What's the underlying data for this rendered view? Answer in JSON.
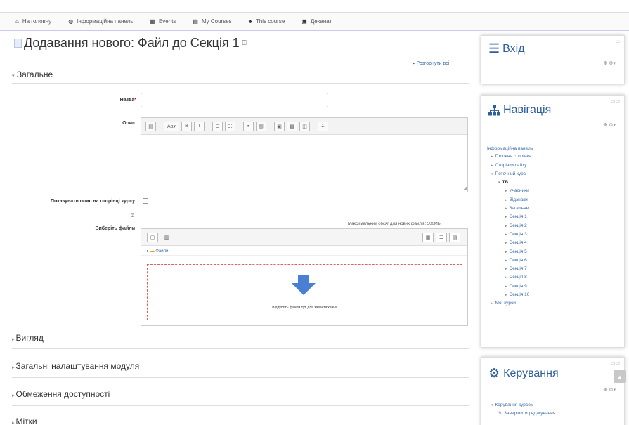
{
  "topnav": {
    "items": [
      {
        "icon": "home-icon",
        "glyph": "⌂",
        "label": "На головну"
      },
      {
        "icon": "dashboard-icon",
        "glyph": "◍",
        "label": "Інформаційна панель"
      },
      {
        "icon": "calendar-icon",
        "glyph": "▦",
        "label": "Events"
      },
      {
        "icon": "courses-icon",
        "glyph": "▤",
        "label": "My Courses"
      },
      {
        "icon": "sitemap-icon",
        "glyph": "♣",
        "label": "This course"
      },
      {
        "icon": "grades-icon",
        "glyph": "▣",
        "label": "Деканат"
      }
    ]
  },
  "page": {
    "title": "Додавання нового: Файл до Секція 1",
    "expand_all": "Розгорнути всі",
    "section_general": "Загальне"
  },
  "form": {
    "name_label": "Назва",
    "required_mark": "*",
    "name_value": "",
    "description_label": "Опис",
    "show_description_label": "Показувати опис на сторінці курсу",
    "select_files_label": "Виберіть файли",
    "max_size_text": "Максимальний обсяг для нових файлів: 500МБ",
    "folder_path": "Файли",
    "drop_text": "Відпустіть файли тут для завантаження"
  },
  "editor": {
    "toolbar": [
      "▤",
      "Aa▾",
      "B",
      "I",
      "☰",
      "☷",
      "⚭",
      "⛓",
      "▣",
      "▩",
      "◫",
      "Σ"
    ]
  },
  "filepicker": {
    "left_buttons": [
      "▢",
      "▥"
    ],
    "right_buttons": [
      "▦",
      "☰",
      "▤"
    ]
  },
  "collapsed_sections": [
    "Вигляд",
    "Загальні налаштування модуля",
    "Обмеження доступності",
    "Мітки"
  ],
  "blocks": {
    "login": {
      "title": "Вхід",
      "tools": "✥ ⚙▾",
      "collapse": "▭"
    },
    "navigation": {
      "title": "Навігація",
      "tools": "✥ ⚙▾",
      "collapse": "▭▭",
      "items": [
        {
          "label": "Інформаційна панель",
          "level": 0,
          "caret": ""
        },
        {
          "label": "Головна сторінка",
          "level": 1,
          "caret": "▸"
        },
        {
          "label": "Сторінки сайту",
          "level": 1,
          "caret": "▸"
        },
        {
          "label": "Поточний курс",
          "level": 1,
          "caret": "▾"
        },
        {
          "label": "ТВ",
          "level": 2,
          "caret": "▾",
          "bold": true
        },
        {
          "label": "Учасники",
          "level": 3,
          "caret": "▸"
        },
        {
          "label": "Відзнаки",
          "level": 3,
          "caret": "▸"
        },
        {
          "label": "Загальне",
          "level": 3,
          "caret": "▸"
        },
        {
          "label": "Секція 1",
          "level": 3,
          "caret": "▸"
        },
        {
          "label": "Секція 2",
          "level": 3,
          "caret": "▸"
        },
        {
          "label": "Секція 3",
          "level": 3,
          "caret": "▸"
        },
        {
          "label": "Секція 4",
          "level": 3,
          "caret": "▸"
        },
        {
          "label": "Секція 5",
          "level": 3,
          "caret": "▸"
        },
        {
          "label": "Секція 6",
          "level": 3,
          "caret": "▸"
        },
        {
          "label": "Секція 7",
          "level": 3,
          "caret": "▸"
        },
        {
          "label": "Секція 8",
          "level": 3,
          "caret": "▸"
        },
        {
          "label": "Секція 9",
          "level": 3,
          "caret": "▸"
        },
        {
          "label": "Секція 10",
          "level": 3,
          "caret": "▸"
        },
        {
          "label": "Мої курси",
          "level": 1,
          "caret": "▸"
        }
      ]
    },
    "admin": {
      "title": "Керування",
      "tools": "✥ ⚙▾",
      "collapse": "▭▭",
      "items": [
        "Керування курсом",
        "Завершити редагування"
      ]
    }
  },
  "colors": {
    "accent": "#2d5f9e",
    "link": "#3a6ba8",
    "dropzone_border": "#e06060",
    "drop_arrow": "#4a7fd4"
  }
}
